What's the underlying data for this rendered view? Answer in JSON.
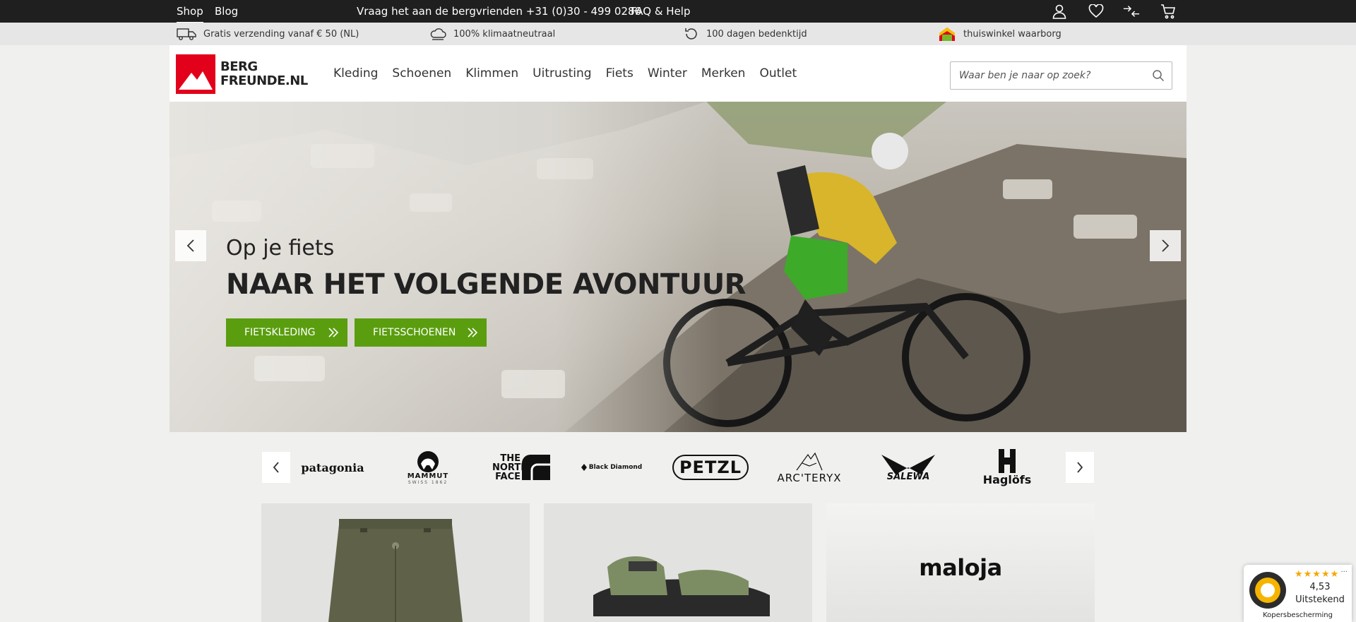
{
  "topbar": {
    "shop": "Shop",
    "blog": "Blog",
    "call_text": "Vraag het aan de bergvrienden +31 (0)30 - 499 0286",
    "faq": "FAQ & Help",
    "icons": [
      "user-icon",
      "heart-icon",
      "compare-icon",
      "cart-icon"
    ]
  },
  "usps": [
    {
      "icon": "truck-icon",
      "text": "Gratis verzending vanaf € 50 (NL)"
    },
    {
      "icon": "cloud-icon",
      "text": "100% klimaatneutraal"
    },
    {
      "icon": "return-icon",
      "text": "100 dagen bedenktijd"
    },
    {
      "icon": "house-icon",
      "text": "thuiswinkel waarborg"
    }
  ],
  "header": {
    "logo_line1": "BERG",
    "logo_line2": "FREUNDE.NL",
    "nav": [
      "Kleding",
      "Schoenen",
      "Klimmen",
      "Uitrusting",
      "Fiets",
      "Winter",
      "Merken",
      "Outlet"
    ],
    "search_placeholder": "Waar ben je naar op zoek?"
  },
  "hero": {
    "subtitle": "Op je fiets",
    "title": "NAAR HET VOLGENDE AVONTUUR",
    "cta1": "Fietskleding",
    "cta2": "Fietsschoenen"
  },
  "brands": [
    "patagonia",
    "MAMMUT",
    "THE NORTH FACE",
    "Black Diamond",
    "PETZL",
    "ARC'TERYX",
    "SALEWA",
    "Haglöfs"
  ],
  "brand_sub": {
    "mammut": "SWISS 1862"
  },
  "tiles": {
    "maloja": "maloja"
  },
  "trust": {
    "stars": "★★★★★",
    "score": "4,53",
    "rating_label": "Uitstekend",
    "buyer": "Kopersbescherming",
    "dots": "..."
  },
  "colors": {
    "topbar": "#1f1f1f",
    "accent_red": "#e2001a",
    "cta_green": "#5a9e0f"
  }
}
